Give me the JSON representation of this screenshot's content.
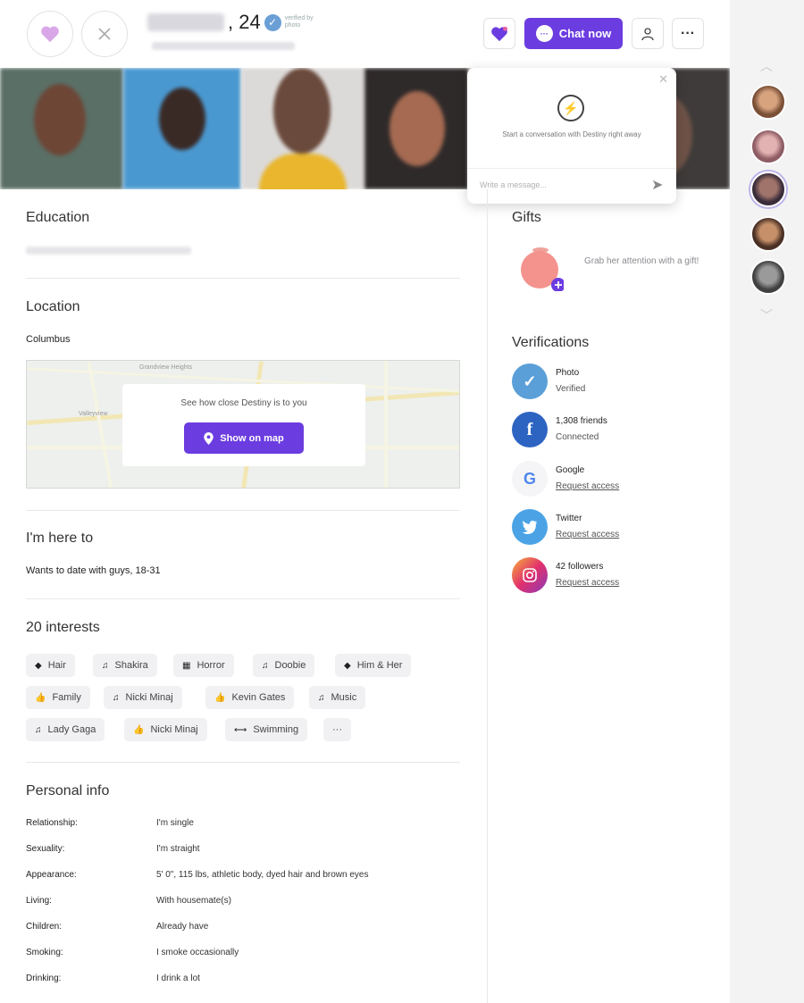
{
  "header": {
    "age": ", 24",
    "verified_text": "verified by photo",
    "chat_label": "Chat now"
  },
  "popup": {
    "text": "Start a conversation with Destiny right away",
    "placeholder": "Write a message..."
  },
  "education": {
    "title": "Education"
  },
  "location": {
    "title": "Location",
    "city": "Columbus",
    "map_text": "See how close Destiny is to you",
    "map_button": "Show on map",
    "map_labels": [
      "Grandview Heights",
      "Valleyview"
    ]
  },
  "here_to": {
    "title": "I'm here to",
    "value": "Wants to date with guys, 18-31"
  },
  "interests": {
    "title": "20 interests",
    "items": [
      {
        "label": "Hair",
        "icon": "diamond-icon"
      },
      {
        "label": "Shakira",
        "icon": "music-note-icon"
      },
      {
        "label": "Horror",
        "icon": "film-icon"
      },
      {
        "label": "Doobie",
        "icon": "music-note-icon"
      },
      {
        "label": "Him & Her",
        "icon": "diamond-icon"
      },
      {
        "label": "Family",
        "icon": "thumbs-up-icon"
      },
      {
        "label": "Nicki Minaj",
        "icon": "music-note-icon"
      },
      {
        "label": "Kevin Gates",
        "icon": "thumbs-up-icon"
      },
      {
        "label": "Music",
        "icon": "music-note-icon"
      },
      {
        "label": "Lady Gaga",
        "icon": "music-note-icon"
      },
      {
        "label": "Nicki Minaj",
        "icon": "thumbs-up-icon"
      },
      {
        "label": "Swimming",
        "icon": "dumbbell-icon"
      }
    ],
    "more": "···"
  },
  "personal_info": {
    "title": "Personal info",
    "rows": [
      {
        "label": "Relationship:",
        "value": "I'm single"
      },
      {
        "label": "Sexuality:",
        "value": "I'm straight"
      },
      {
        "label": "Appearance:",
        "value": "5' 0\", 115 lbs, athletic body, dyed hair and brown eyes"
      },
      {
        "label": "Living:",
        "value": "With housemate(s)"
      },
      {
        "label": "Children:",
        "value": "Already have"
      },
      {
        "label": "Smoking:",
        "value": "I smoke occasionally"
      },
      {
        "label": "Drinking:",
        "value": "I drink a lot"
      }
    ]
  },
  "gifts": {
    "title": "Gifts",
    "text": "Grab her attention with a gift!"
  },
  "verifications": {
    "title": "Verifications",
    "items": [
      {
        "title": "Photo",
        "sub": "Verified",
        "link": false,
        "icon": "checkmark-icon"
      },
      {
        "title": "1,308 friends",
        "sub": "Connected",
        "link": false,
        "icon": "facebook-icon"
      },
      {
        "title": "Google",
        "sub": "Request access",
        "link": true,
        "icon": "google-icon"
      },
      {
        "title": "Twitter",
        "sub": "Request access",
        "link": true,
        "icon": "twitter-icon"
      },
      {
        "title": "42 followers",
        "sub": "Request access",
        "link": true,
        "icon": "instagram-icon"
      }
    ]
  },
  "colors": {
    "accent": "#6b3ce0",
    "facebook": "#2d64c2",
    "twitter": "#4ba3e6",
    "photo_verified": "#5b9fd8"
  }
}
